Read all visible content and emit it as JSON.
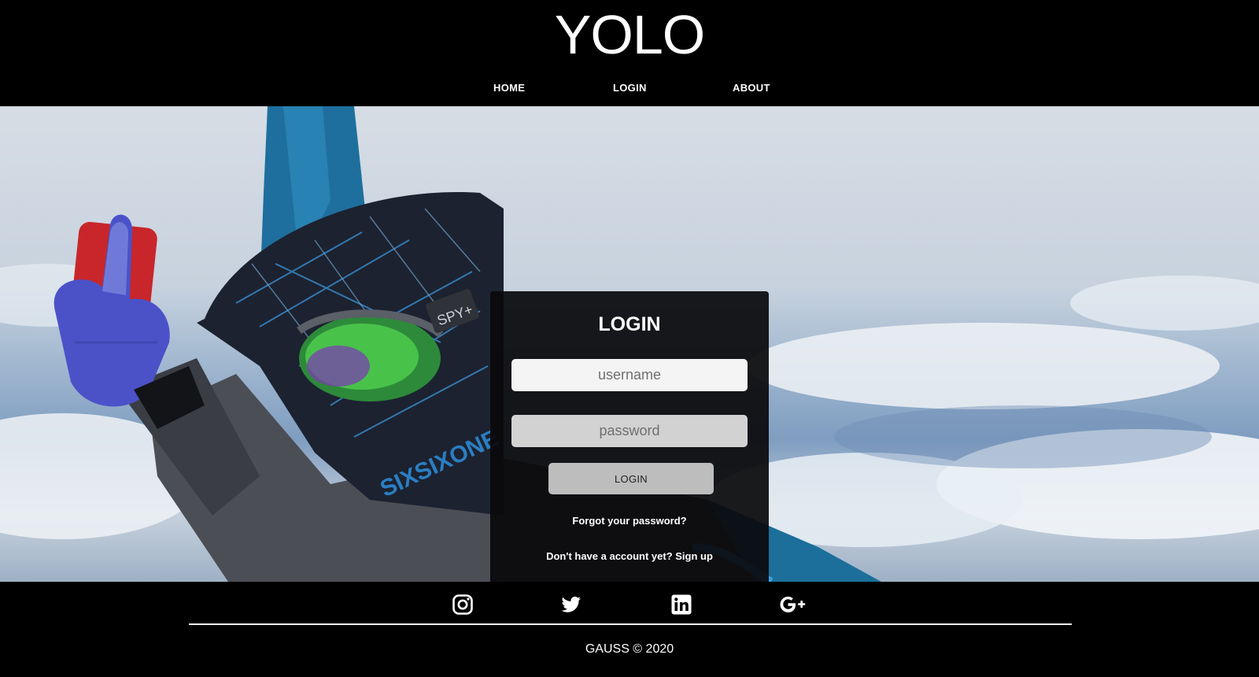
{
  "header": {
    "logo": "YOLO",
    "nav": [
      {
        "label": "HOME"
      },
      {
        "label": "LOGIN"
      },
      {
        "label": "ABOUT"
      }
    ]
  },
  "login_card": {
    "title": "LOGIN",
    "username_placeholder": "username",
    "password_placeholder": "password",
    "button_label": "LOGIN",
    "forgot_link": "Forgot your password?",
    "signup_link": "Don't have a account yet? Sign up"
  },
  "footer": {
    "social_icons": [
      "instagram-icon",
      "twitter-icon",
      "linkedin-icon",
      "google-plus-icon"
    ],
    "copyright": "GAUSS © 2020"
  },
  "colors": {
    "header_bg": "#000000",
    "card_bg": "#0a0a0c",
    "footer_bg": "#000000"
  }
}
